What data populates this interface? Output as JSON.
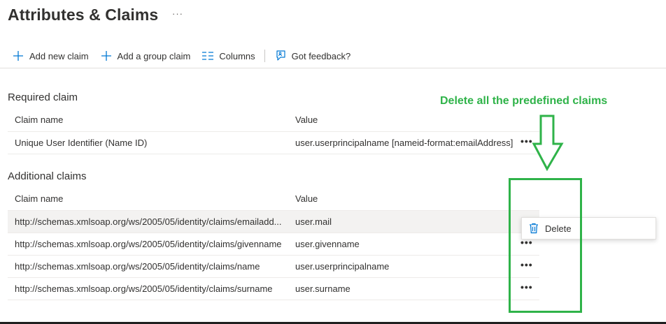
{
  "page": {
    "title": "Attributes & Claims",
    "more_label": "···"
  },
  "toolbar": {
    "add_new_claim": "Add new claim",
    "add_group_claim": "Add a group claim",
    "columns": "Columns",
    "feedback": "Got feedback?"
  },
  "required": {
    "title": "Required claim",
    "headers": {
      "name": "Claim name",
      "value": "Value"
    },
    "rows": [
      {
        "name": "Unique User Identifier (Name ID)",
        "value": "user.userprincipalname [nameid-format:emailAddress]",
        "more": "•••"
      }
    ]
  },
  "additional": {
    "title": "Additional claims",
    "headers": {
      "name": "Claim name",
      "value": "Value"
    },
    "rows": [
      {
        "name": "http://schemas.xmlsoap.org/ws/2005/05/identity/claims/emailadd...",
        "value": "user.mail",
        "more": ""
      },
      {
        "name": "http://schemas.xmlsoap.org/ws/2005/05/identity/claims/givenname",
        "value": "user.givenname",
        "more": "•••"
      },
      {
        "name": "http://schemas.xmlsoap.org/ws/2005/05/identity/claims/name",
        "value": "user.userprincipalname",
        "more": "•••"
      },
      {
        "name": "http://schemas.xmlsoap.org/ws/2005/05/identity/claims/surname",
        "value": "user.surname",
        "more": "•••"
      }
    ]
  },
  "context_menu": {
    "delete_label": "Delete"
  },
  "annotation": {
    "text": "Delete all the predefined claims",
    "color": "#2fb349"
  },
  "colors": {
    "accent": "#0078d4",
    "highlight_row": "#f3f2f1",
    "annotation": "#2fb349"
  }
}
